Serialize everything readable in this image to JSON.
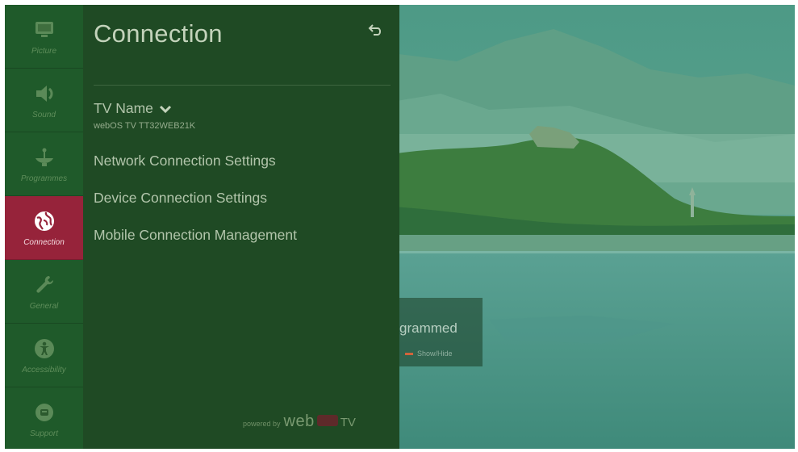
{
  "sidebar": {
    "items": [
      {
        "label": "Picture",
        "icon": "monitor-icon"
      },
      {
        "label": "Sound",
        "icon": "speaker-icon"
      },
      {
        "label": "Programmes",
        "icon": "satellite-dish-icon"
      },
      {
        "label": "Connection",
        "icon": "globe-icon",
        "active": true
      },
      {
        "label": "General",
        "icon": "wrench-icon"
      },
      {
        "label": "Accessibility",
        "icon": "accessibility-icon"
      },
      {
        "label": "Support",
        "icon": "support-icon"
      }
    ],
    "active_color": "#96233a"
  },
  "panel": {
    "title": "Connection",
    "back_icon": "back-arrow-icon",
    "tv_name": {
      "label": "TV Name",
      "value": "webOS TV TT32WEB21K"
    },
    "items": [
      "Network Connection Settings",
      "Device Connection Settings",
      "Mobile Connection Management"
    ],
    "powered_by": {
      "prefix": "powered by",
      "brand": "web",
      "suffix": "TV"
    }
  },
  "notice": {
    "text": "grammed",
    "hint": "Show/Hide"
  }
}
